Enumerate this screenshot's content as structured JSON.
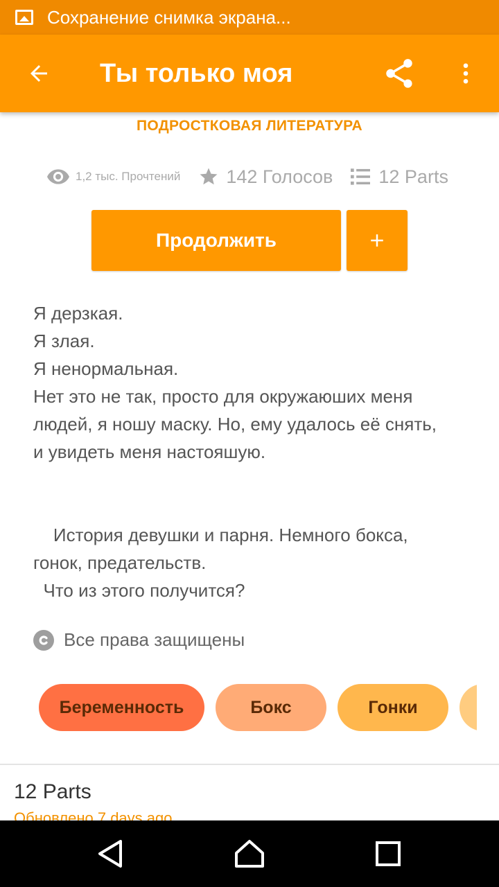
{
  "status_bar": {
    "notification_text": "Сохранение снимка экрана...",
    "icon": "image-icon"
  },
  "app_bar": {
    "title": "Ты только моя",
    "back_icon": "arrow-left-icon",
    "share_icon": "share-icon",
    "more_icon": "more-vert-icon"
  },
  "story": {
    "category": "ПОДРОСТКОВАЯ ЛИТЕРАТУРА",
    "stats": {
      "reads": "1,2 тыс. Прочтений",
      "votes": "142 Голосов",
      "parts": "12 Parts"
    },
    "continue_label": "Продолжить",
    "add_label": "+",
    "description": [
      "Я дерзкая.",
      "Я злая.",
      "Я ненормальная.",
      "Нет это не так, просто для окружаюших меня",
      "людей, я ношу маску. Но, ему удалось её снять,",
      "и увидеть меня настояшую.",
      "",
      "",
      "    История девушки и парня. Немного бокса,",
      "гонок, предательств.",
      "  Что из этого получится?"
    ],
    "copyright": "Все права защищены",
    "tags": [
      {
        "label": "Беременность",
        "color": "#ff7043"
      },
      {
        "label": "Бокс",
        "color": "#ffab76"
      },
      {
        "label": "Гонки",
        "color": "#ffb74d"
      },
      {
        "label": "",
        "color": "#ffcc80"
      }
    ]
  },
  "parts_section": {
    "title": "12 Parts",
    "updated": "Обновлено 7 days ago"
  },
  "colors": {
    "status_bar": "#f08a00",
    "app_bar": "#ff9800",
    "accent": "#f29100"
  }
}
